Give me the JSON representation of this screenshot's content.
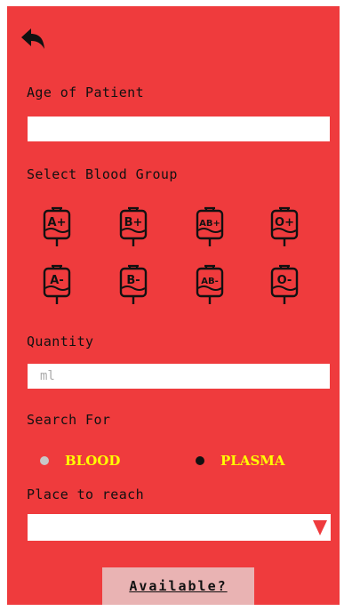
{
  "colors": {
    "panel_bg": "#ef3b3d",
    "radio_label": "#ffff00",
    "button_bg": "#e9b3b3"
  },
  "header": {
    "back_icon": "reply-arrow-icon"
  },
  "age": {
    "label": "Age of Patient",
    "value": ""
  },
  "blood_group": {
    "label": "Select Blood Group",
    "groups": [
      "A+",
      "B+",
      "AB+",
      "O+",
      "A-",
      "B-",
      "AB-",
      "O-"
    ],
    "icon": "blood-bag-icon"
  },
  "quantity": {
    "label": "Quantity",
    "placeholder": "ml",
    "value": ""
  },
  "search_for": {
    "label": "Search For",
    "options": [
      {
        "label": "BLOOD",
        "dot_color": "#c8c8c8",
        "selected": false
      },
      {
        "label": "PLASMA",
        "dot_color": "#111111",
        "selected": true
      }
    ]
  },
  "place": {
    "label": "Place to reach",
    "value": ""
  },
  "submit": {
    "label": "Available?"
  }
}
